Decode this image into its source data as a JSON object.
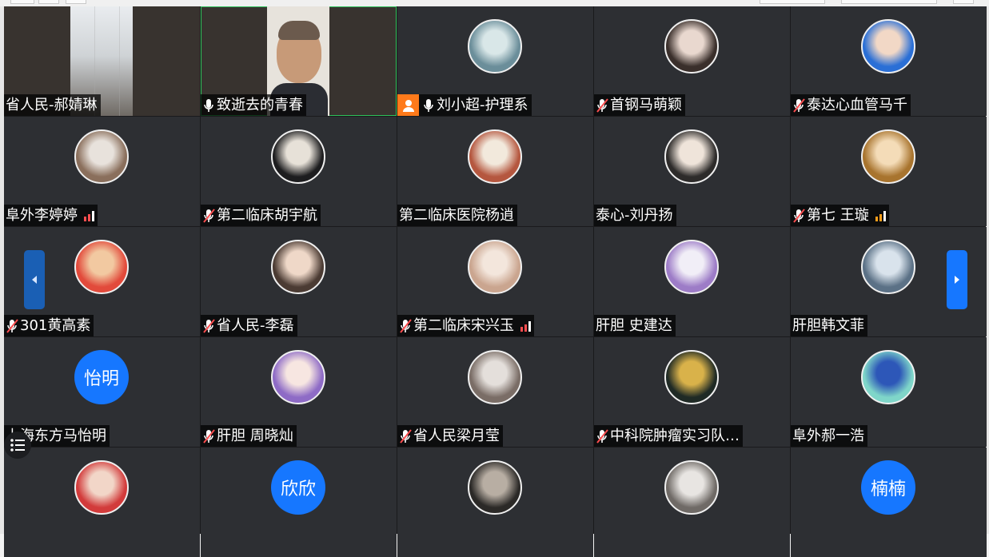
{
  "participants": [
    {
      "name": "省人民-郝婧琳",
      "type": "video",
      "video": "room",
      "mic": "none",
      "signal": null
    },
    {
      "name": "致逝去的青春",
      "type": "video",
      "video": "face",
      "mic": "on",
      "signal": null,
      "active": true
    },
    {
      "name": "刘小超-护理系",
      "type": "photo",
      "mic": "on",
      "host": true,
      "signal": null,
      "colors": [
        "#6b8e9a",
        "#d9e7e8"
      ]
    },
    {
      "name": "首钢马萌颖",
      "type": "photo",
      "mic": "muted",
      "signal": null,
      "colors": [
        "#3a2f2b",
        "#e9d8cf"
      ]
    },
    {
      "name": "泰达心血管马千",
      "type": "photo",
      "mic": "muted",
      "signal": null,
      "colors": [
        "#2a6fd6",
        "#f2d8c6"
      ]
    },
    {
      "name": "阜外李婷婷",
      "type": "photo",
      "mic": "none",
      "signal": "red",
      "colors": [
        "#8a6f5c",
        "#e8e2dc"
      ]
    },
    {
      "name": "第二临床胡宇航",
      "type": "photo",
      "mic": "muted",
      "signal": null,
      "colors": [
        "#1d1d1f",
        "#e7e1d8"
      ]
    },
    {
      "name": "第二临床医院杨逍",
      "type": "photo",
      "mic": "none",
      "signal": null,
      "colors": [
        "#b5573f",
        "#f2e9dc"
      ]
    },
    {
      "name": "泰心-刘丹扬",
      "type": "photo",
      "mic": "none",
      "signal": null,
      "colors": [
        "#2d2b2a",
        "#efe4da"
      ]
    },
    {
      "name": "第七 王璇",
      "type": "photo",
      "mic": "muted",
      "signal": "orange",
      "colors": [
        "#a8742e",
        "#f4dcb8"
      ]
    },
    {
      "name": "301黄高素",
      "type": "photo",
      "mic": "muted",
      "signal": null,
      "colors": [
        "#e24a3b",
        "#f2c9a1"
      ]
    },
    {
      "name": "省人民-李磊",
      "type": "photo",
      "mic": "muted",
      "signal": null,
      "colors": [
        "#4b3b33",
        "#efd8c8"
      ]
    },
    {
      "name": "第二临床宋兴玉",
      "type": "photo",
      "mic": "muted",
      "signal": "red",
      "colors": [
        "#caa58f",
        "#f3e6dc"
      ]
    },
    {
      "name": "肝胆 史建达",
      "type": "photo",
      "mic": "none",
      "signal": null,
      "colors": [
        "#9d7cc7",
        "#f1eef7"
      ]
    },
    {
      "name": "肝胆韩文菲",
      "type": "photo",
      "mic": "none",
      "signal": null,
      "colors": [
        "#5b7186",
        "#d9e3ec"
      ]
    },
    {
      "name": "上海东方马怡明",
      "type": "text",
      "avatar_text": "怡明",
      "mic": "none",
      "signal": null
    },
    {
      "name": "肝胆 周晓灿",
      "type": "photo",
      "mic": "muted",
      "signal": null,
      "colors": [
        "#8e6bc6",
        "#f7e6e1"
      ]
    },
    {
      "name": "省人民梁月莹",
      "type": "photo",
      "mic": "muted",
      "signal": null,
      "colors": [
        "#7a6d66",
        "#e4dfdb"
      ]
    },
    {
      "name": "中科院肿瘤实习队…",
      "type": "photo",
      "mic": "muted",
      "signal": null,
      "colors": [
        "#1f2a25",
        "#d9b24a"
      ]
    },
    {
      "name": "阜外郝一浩",
      "type": "photo",
      "mic": "none",
      "signal": null,
      "colors": [
        "#7fd6c9",
        "#2d57b8"
      ]
    },
    {
      "name": "",
      "type": "photo",
      "mic": "none",
      "signal": null,
      "colors": [
        "#d23b3b",
        "#f2d6c8"
      ]
    },
    {
      "name": "",
      "type": "text",
      "avatar_text": "欣欣",
      "mic": "none",
      "signal": null
    },
    {
      "name": "",
      "type": "photo",
      "mic": "none",
      "signal": null,
      "colors": [
        "#2b2927",
        "#b8aea3"
      ]
    },
    {
      "name": "",
      "type": "photo",
      "mic": "none",
      "signal": null,
      "colors": [
        "#6f6a66",
        "#e8e5e2"
      ]
    },
    {
      "name": "",
      "type": "text",
      "avatar_text": "楠楠",
      "mic": "none",
      "signal": null
    }
  ],
  "nav": {
    "prev_icon": "chevron-left-icon",
    "next_icon": "chevron-right-icon"
  },
  "menu": {
    "icon": "list-menu-icon"
  },
  "colors": {
    "tile_bg": "#2d2f33",
    "accent_blue": "#1677ff",
    "host_orange": "#ff7a1a",
    "muted_red": "#ff4d4f",
    "active_green": "#2fc25b"
  }
}
